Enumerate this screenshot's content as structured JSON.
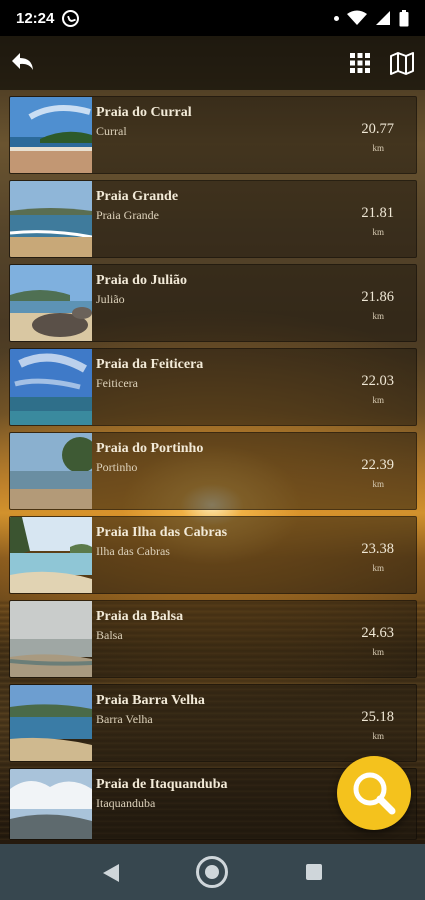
{
  "status_bar": {
    "time": "12:24",
    "icons": [
      "whatsapp-icon",
      "dot-icon",
      "wifi-icon",
      "signal-icon",
      "battery-icon"
    ]
  },
  "app_bar": {
    "icons": [
      "back-arrow-icon",
      "grid-icon",
      "map-icon"
    ]
  },
  "beaches": [
    {
      "name": "Praia do Curral",
      "area": "Curral",
      "distance": "20.77",
      "unit": "km"
    },
    {
      "name": "Praia Grande",
      "area": "Praia Grande",
      "distance": "21.81",
      "unit": "km"
    },
    {
      "name": "Praia do Julião",
      "area": "Julião",
      "distance": "21.86",
      "unit": "km"
    },
    {
      "name": "Praia da Feiticera",
      "area": "Feiticera",
      "distance": "22.03",
      "unit": "km"
    },
    {
      "name": "Praia do Portinho",
      "area": "Portinho",
      "distance": "22.39",
      "unit": "km"
    },
    {
      "name": "Praia Ilha das Cabras",
      "area": "Ilha das Cabras",
      "distance": "23.38",
      "unit": "km"
    },
    {
      "name": "Praia da Balsa",
      "area": "Balsa",
      "distance": "24.63",
      "unit": "km"
    },
    {
      "name": "Praia Barra Velha",
      "area": "Barra Velha",
      "distance": "25.18",
      "unit": "km"
    },
    {
      "name": "Praia de Itaquanduba",
      "area": "Itaquanduba",
      "distance": "",
      "unit": ""
    }
  ],
  "search_fab": {
    "icon": "search-icon",
    "color": "#f4c21d"
  },
  "nav_bar": {
    "icons": [
      "nav-back-icon",
      "nav-home-icon",
      "nav-recents-icon"
    ]
  }
}
